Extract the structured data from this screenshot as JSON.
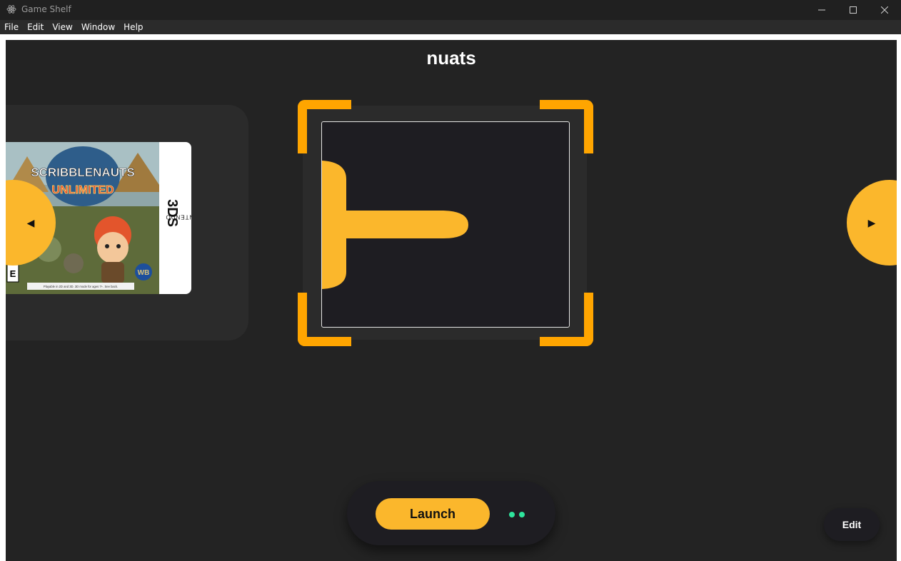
{
  "window": {
    "title": "Game Shelf",
    "icons": {
      "app": "electron-app-icon",
      "minimize": "minimize-icon",
      "maximize": "maximize-icon",
      "close": "close-icon"
    }
  },
  "menu": {
    "items": [
      {
        "label": "File"
      },
      {
        "label": "Edit"
      },
      {
        "label": "View"
      },
      {
        "label": "Window"
      },
      {
        "label": "Help"
      }
    ]
  },
  "main": {
    "game_title": "nuats",
    "previous_game": {
      "cover_title_line1": "SCRIBBLENAUTS",
      "cover_title_line2": "UNLIMITED",
      "platform_small": "NINTENDO",
      "platform_large": "3DS",
      "rating": "E",
      "publisher": "WB",
      "cover_caption": "Playable in 2D and 3D. 3D mode for ages 7+. See back."
    },
    "nav": {
      "prev_glyph": "◀",
      "next_glyph": "▶"
    },
    "launch_label": "Launch",
    "edit_label": "Edit",
    "colors": {
      "accent": "#fbb72c",
      "focus_corners": "#ffa500",
      "status_dot": "#2ee59d",
      "background": "#232323"
    }
  }
}
